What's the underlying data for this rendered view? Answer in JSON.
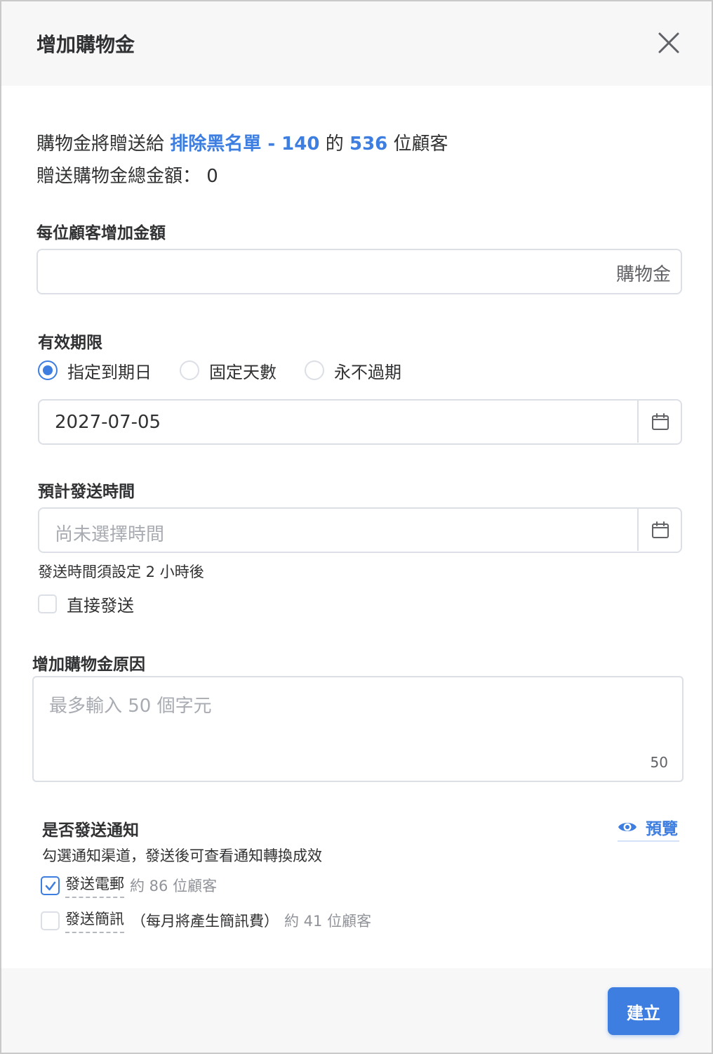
{
  "dialog": {
    "title": "增加購物金",
    "close_icon": "close-icon"
  },
  "summary": {
    "line1_prefix": "購物金將贈送給",
    "group_name": "排除黑名單 - 140",
    "line1_mid": "的",
    "customer_count": "536",
    "line1_suffix": "位顧客",
    "line2_label": "贈送購物金總金額：",
    "line2_value": "0"
  },
  "amount": {
    "label": "每位顧客增加金額",
    "value": "",
    "suffix": "購物金"
  },
  "expiry": {
    "label": "有效期限",
    "options": [
      "指定到期日",
      "固定天數",
      "永不過期"
    ],
    "selected": "指定到期日",
    "date_value": "2027-07-05",
    "calendar_icon": "calendar-icon"
  },
  "schedule": {
    "label": "預計發送時間",
    "placeholder": "尚未選擇時間",
    "hint": "發送時間須設定 2 小時後",
    "send_now_label": "直接發送",
    "send_now_checked": false
  },
  "reason": {
    "label": "增加購物金原因",
    "placeholder": "最多輸入 50 個字元",
    "counter": "50"
  },
  "notification": {
    "title": "是否發送通知",
    "preview_label": "預覽",
    "preview_icon": "eye-icon",
    "description": "勾選通知渠道，發送後可查看通知轉換成效",
    "channels": [
      {
        "label": "發送電郵",
        "extra": "",
        "count": "約 86 位顧客",
        "checked": true
      },
      {
        "label": "發送簡訊",
        "extra": "（每月將產生簡訊費）",
        "count": "約 41 位顧客",
        "checked": false
      }
    ]
  },
  "footer": {
    "create_label": "建立"
  },
  "colors": {
    "accent": "#3d7ee0",
    "border": "#dcdfe6",
    "header_bg": "#f7f7f8",
    "placeholder": "#a8abb2"
  }
}
